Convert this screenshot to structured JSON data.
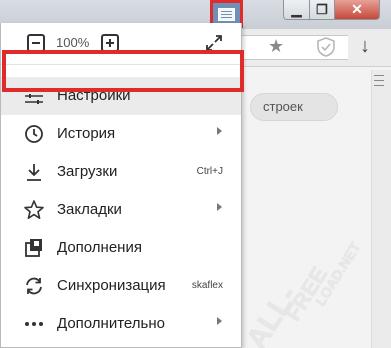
{
  "zoom": {
    "value": "100%"
  },
  "window_controls": {
    "minimize": "▁",
    "maximize": "❐",
    "close": "✕"
  },
  "toolbar": {
    "search_placeholder": "строек"
  },
  "menu": {
    "items": [
      {
        "label": "Настройки",
        "icon": "sliders-icon",
        "highlighted": true
      },
      {
        "label": "История",
        "icon": "clock-icon",
        "has_submenu": true
      },
      {
        "label": "Загрузки",
        "icon": "download-icon",
        "shortcut": "Ctrl+J"
      },
      {
        "label": "Закладки",
        "icon": "star-icon",
        "has_submenu": true
      },
      {
        "label": "Дополнения",
        "icon": "extensions-icon"
      },
      {
        "label": "Синхронизация",
        "icon": "sync-icon",
        "shortcut": "skaflex"
      },
      {
        "label": "Дополнительно",
        "icon": "more-icon",
        "has_submenu": true
      }
    ]
  },
  "watermark": {
    "line1": "ALL-",
    "line2": "FREE",
    "line3": "LOAD.NET"
  },
  "colors": {
    "highlight_frame": "#e02b2b",
    "menu_button": "#6f8fb8",
    "close_button": "#c6493a"
  }
}
